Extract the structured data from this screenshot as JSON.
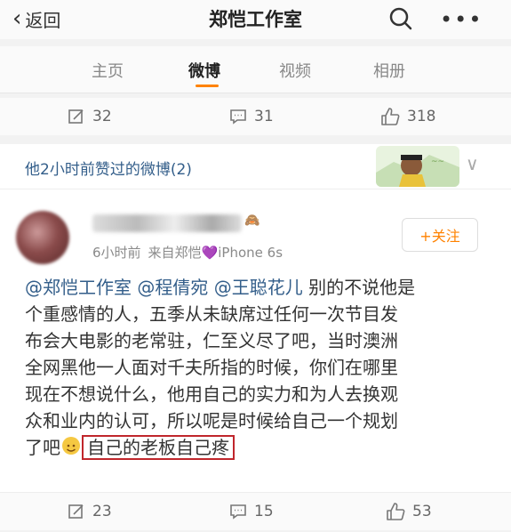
{
  "nav": {
    "back_label": "返回",
    "title": "郑恺工作室",
    "more_label": "•••"
  },
  "tabs": [
    "主页",
    "微博",
    "视频",
    "相册"
  ],
  "top_actions": {
    "repost": "32",
    "comment": "31",
    "like": "318"
  },
  "liked_bar": {
    "text": "他2小时前赞过的微博(2)"
  },
  "post": {
    "meta_time": "6小时前",
    "meta_source": "来自郑恺",
    "meta_device": "iPhone 6s",
    "follow_label": "+关注",
    "mentions": [
      "@郑恺工作室",
      "@程倩宛",
      "@王聪花儿"
    ],
    "line1_text": "别的不说他是",
    "line2": "个重感情的人，五季从未缺席过任何一次节目发",
    "line3": "布会大电影的老常驻，仁至义尽了吧，当时澳洲",
    "line4": "全网黑他一人面对千夫所指的时候，你们在哪里",
    "line5": "现在不想说什么，他用自己的实力和为人去换观",
    "line6": "众和业内的认可，所以呢是时候给自己一个规划",
    "line7_pre": "了吧",
    "line7_boxed": "自己的老板自己疼"
  },
  "bottom_actions": {
    "repost": "23",
    "comment": "15",
    "like": "53"
  },
  "colors": {
    "accent": "#ff8200",
    "link": "#335e8a",
    "highlight_box": "#c0262c"
  }
}
